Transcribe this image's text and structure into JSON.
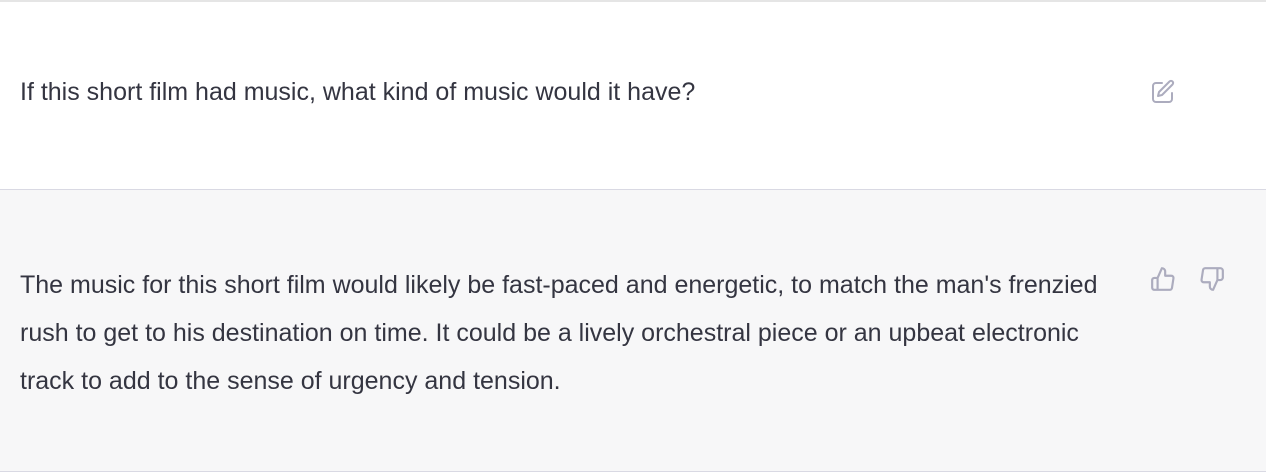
{
  "colors": {
    "user_background": "#ffffff",
    "assistant_background": "#f7f7f8",
    "text": "#343541",
    "icon": "#acacbe",
    "divider": "#d9d9e3"
  },
  "conversation": {
    "user_message": {
      "text": "If this short film had music, what kind of music would it have?",
      "action_icon": "edit-icon"
    },
    "assistant_message": {
      "text": "The music for this short film would likely be fast-paced and energetic, to match the man's frenzied rush to get to his destination on time. It could be a lively orchestral piece or an upbeat electronic track to add to the sense of urgency and tension.",
      "feedback_icons": [
        "thumbs-up-icon",
        "thumbs-down-icon"
      ]
    }
  }
}
